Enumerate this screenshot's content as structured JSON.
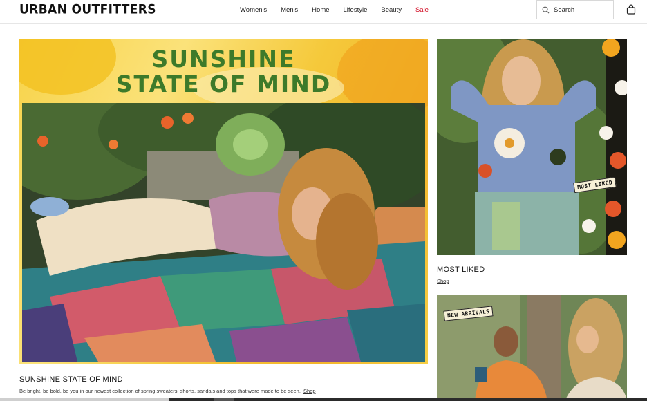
{
  "brand": {
    "logo_text": "URBAN OUTFITTERS"
  },
  "nav": {
    "items": [
      {
        "label": "Women's"
      },
      {
        "label": "Men's"
      },
      {
        "label": "Home"
      },
      {
        "label": "Lifestyle"
      },
      {
        "label": "Beauty"
      },
      {
        "label": "Sale"
      }
    ],
    "sale_color": "#d0021b"
  },
  "search": {
    "placeholder": "Search",
    "icon": "search-icon"
  },
  "cart": {
    "icon": "shopping-bag-icon"
  },
  "hero": {
    "headline_line1": "SUNSHINE",
    "headline_line2": "STATE OF MIND",
    "headline_color": "#3d7a2a",
    "caption_title": "SUNSHINE STATE OF MIND",
    "caption_body": "Be bright, be bold, be you in our newest collection of spring sweaters, shorts, sandals and tops that were made to be seen.",
    "caption_link": "Shop"
  },
  "tiles": [
    {
      "badge": "MOST LIKED",
      "title": "MOST LIKED",
      "link": "Shop"
    },
    {
      "badge": "NEW ARRIVALS"
    }
  ]
}
